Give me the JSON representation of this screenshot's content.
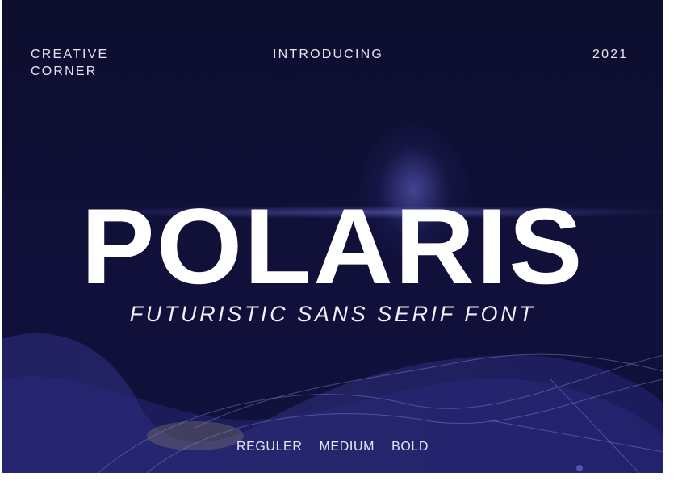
{
  "header": {
    "brand_line1": "CREATIVE",
    "brand_line2": "CORNER",
    "center": "INTRODUCING",
    "year": "2021"
  },
  "title": "POLARIS",
  "subtitle": "FUTURISTIC SANS SERIF FONT",
  "weights": [
    "REGULER",
    "MEDIUM",
    "BOLD"
  ],
  "colors": {
    "background": "#0f0f30",
    "accent": "#4a4ab0",
    "text": "#ffffff"
  }
}
